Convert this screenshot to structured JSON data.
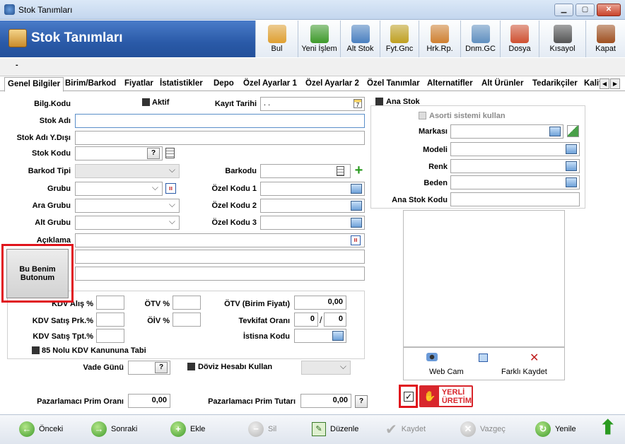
{
  "window": {
    "title": "Stok Tanımları"
  },
  "header": {
    "title": "Stok Tanımları"
  },
  "toolbar": {
    "items": [
      {
        "label": "Bul",
        "icon": "search-folder-icon",
        "color": "#e0a030"
      },
      {
        "label": "Yeni İşlem",
        "icon": "plus-icon",
        "color": "#3e9a2a"
      },
      {
        "label": "Alt Stok",
        "icon": "network-icon",
        "color": "#4a80c0"
      },
      {
        "label": "Fyt.Gnc",
        "icon": "coins-icon",
        "color": "#c0a020"
      },
      {
        "label": "Hrk.Rp.",
        "icon": "report-icon",
        "color": "#d08030"
      },
      {
        "label": "Dnm.GC",
        "icon": "document-icon",
        "color": "#6090c0"
      },
      {
        "label": "Dosya",
        "icon": "folder-icon",
        "color": "#d05030"
      },
      {
        "label": "Kısayol",
        "icon": "keyboard-icon",
        "color": "#555555"
      },
      {
        "label": "Kapat",
        "icon": "door-icon",
        "color": "#a05020"
      }
    ]
  },
  "strip": {
    "text": "-"
  },
  "tabs": [
    "Genel Bilgiler",
    "Birim/Barkod",
    "Fiyatlar",
    "İstatistikler",
    "Depo",
    "Özel Ayarlar 1",
    "Özel Ayarlar 2",
    "Özel Tanımlar",
    "Alternatifler",
    "Alt Ürünler",
    "Tedarikçiler",
    "Kalit"
  ],
  "form": {
    "bilg_kodu": "Bilg.Kodu",
    "aktif": "Aktif",
    "kayit_tarihi": "Kayıt Tarihi",
    "kayit_tarihi_value": ". .",
    "stok_adi": "Stok Adı",
    "stok_adi_yd": "Stok Adı Y.Dışı",
    "stok_kodu": "Stok Kodu",
    "barkod_tipi": "Barkod Tipi",
    "barkodu": "Barkodu",
    "grubu": "Grubu",
    "ozel_kodu_1": "Özel Kodu 1",
    "ara_grubu": "Ara Grubu",
    "ozel_kodu_2": "Özel Kodu 2",
    "alt_grubu": "Alt Grubu",
    "ozel_kodu_3": "Özel Kodu 3",
    "aciklama": "Açıklama",
    "custom_button": "Bu Benim Butonum",
    "kdv_alis": "KDV Alış %",
    "otv": "ÖTV %",
    "otv_birim": "ÖTV (Birim Fiyatı)",
    "otv_birim_value": "0,00",
    "kdv_satis_prk": "KDV Satış Prk.%",
    "oiv": "ÖİV %",
    "tevkifat": "Tevkifat Oranı",
    "tevkifat_a": "0",
    "tevkifat_sep": "/",
    "tevkifat_b": "0",
    "kdv_satis_tpt": "KDV Satış Tpt.%",
    "istisna": "İstisna Kodu",
    "kanun85": "85 Nolu KDV Kanununa Tabi",
    "vade_gunu": "Vade Günü",
    "doviz": "Döviz Hesabı Kullan",
    "prim_orani": "Pazarlamacı Prim Oranı",
    "prim_orani_value": "0,00",
    "prim_tutari": "Pazarlamacı Prim Tutarı",
    "prim_tutari_value": "0,00"
  },
  "right": {
    "ana_stok": "Ana Stok",
    "asorti": "Asorti sistemi kullan",
    "markasi": "Markası",
    "modeli": "Modeli",
    "renk": "Renk",
    "beden": "Beden",
    "ana_stok_kodu": "Ana Stok Kodu",
    "webcam": "Web Cam",
    "farkli_kaydet": "Farklı Kaydet",
    "badge_line1": "YERLİ",
    "badge_line2": "ÜRETİM"
  },
  "bottom": {
    "onceki": "Önceki",
    "sonraki": "Sonraki",
    "ekle": "Ekle",
    "sil": "Sil",
    "duzenle": "Düzenle",
    "kaydet": "Kaydet",
    "vazgec": "Vazgeç",
    "yenile": "Yenile"
  },
  "colors": {
    "header": "#2a5aa8",
    "highlight": "#e0141c",
    "badge": "#d8262c"
  }
}
